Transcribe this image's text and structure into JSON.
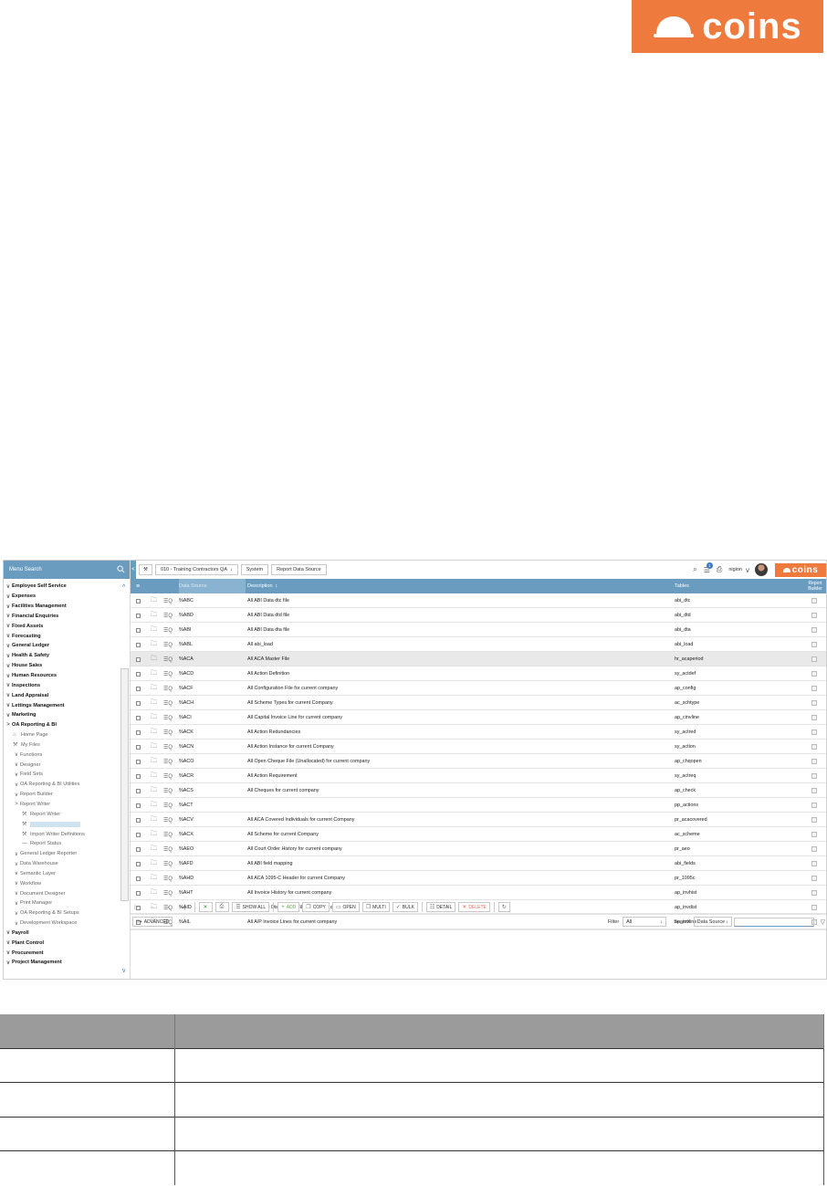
{
  "brand": {
    "logo_text": "coins",
    "accent_color": "#ee7a3d",
    "header_color": "#6a9cc0"
  },
  "sidebar": {
    "search_label": "Menu Search",
    "items": [
      {
        "label": "Employee Self Service",
        "level": "top",
        "chevron": "v"
      },
      {
        "label": "Expenses",
        "level": "top",
        "chevron": "v"
      },
      {
        "label": "Facilities Management",
        "level": "top",
        "chevron": "v"
      },
      {
        "label": "Financial Enquiries",
        "level": "top",
        "chevron": "v"
      },
      {
        "label": "Fixed Assets",
        "level": "top",
        "chevron": "v"
      },
      {
        "label": "Forecasting",
        "level": "top",
        "chevron": "v"
      },
      {
        "label": "General Ledger",
        "level": "top",
        "chevron": "v"
      },
      {
        "label": "Health & Safety",
        "level": "top",
        "chevron": "v"
      },
      {
        "label": "House Sales",
        "level": "top",
        "chevron": "v"
      },
      {
        "label": "Human Resources",
        "level": "top",
        "chevron": "v"
      },
      {
        "label": "Inspections",
        "level": "top",
        "chevron": "v"
      },
      {
        "label": "Land Appraisal",
        "level": "top",
        "chevron": "v"
      },
      {
        "label": "Lettings Management",
        "level": "top",
        "chevron": "v"
      },
      {
        "label": "Marketing",
        "level": "top",
        "chevron": "v"
      },
      {
        "label": "OA Reporting & BI",
        "level": "top",
        "chevron": ">"
      },
      {
        "label": "Home Page",
        "level": "l1",
        "icon": "home-icon"
      },
      {
        "label": "My Files",
        "level": "l1",
        "icon": "tool-icon"
      },
      {
        "label": "Functions",
        "level": "l1",
        "chevron": "v"
      },
      {
        "label": "Designer",
        "level": "l1",
        "chevron": "v"
      },
      {
        "label": "Field Sets",
        "level": "l1",
        "chevron": "v"
      },
      {
        "label": "OA Reporting & BI Utilities",
        "level": "l1",
        "chevron": "v"
      },
      {
        "label": "Report Builder",
        "level": "l1",
        "chevron": "v"
      },
      {
        "label": "Report Writer",
        "level": "l1",
        "chevron": ">"
      },
      {
        "label": "Report Writer",
        "level": "l2",
        "icon": "tool-icon"
      },
      {
        "label": "Report Data Source",
        "level": "l2",
        "icon": "tool-icon",
        "selected": true
      },
      {
        "label": "Import Writer Definitions",
        "level": "l2",
        "icon": "tool-icon"
      },
      {
        "label": "Report Status",
        "level": "l2",
        "icon": "dash-icon"
      },
      {
        "label": "General Ledger Reporter",
        "level": "l1",
        "chevron": "v"
      },
      {
        "label": "Data Warehouse",
        "level": "l1",
        "chevron": "v"
      },
      {
        "label": "Semantic Layer",
        "level": "l1",
        "chevron": "v"
      },
      {
        "label": "Workflow",
        "level": "l1",
        "chevron": "v"
      },
      {
        "label": "Document Designer",
        "level": "l1",
        "chevron": "v"
      },
      {
        "label": "Print Manager",
        "level": "l1",
        "chevron": "v"
      },
      {
        "label": "OA Reporting & BI Setups",
        "level": "l1",
        "chevron": "v"
      },
      {
        "label": "Development Workspace",
        "level": "l1",
        "chevron": "v"
      },
      {
        "label": "Payroll",
        "level": "top",
        "chevron": "v"
      },
      {
        "label": "Plant Control",
        "level": "top",
        "chevron": "v"
      },
      {
        "label": "Procurement",
        "level": "top",
        "chevron": "v"
      },
      {
        "label": "Project Management",
        "level": "top",
        "chevron": "v"
      }
    ]
  },
  "topbar": {
    "collapse": "<",
    "breadcrumbs": [
      "010 - Training Contractors QA",
      "System",
      "Report Data Source"
    ],
    "notification_count": "1",
    "user": "nigion",
    "logo_text": "coins"
  },
  "grid": {
    "headers": {
      "data_source": "Data Source",
      "description": "Description",
      "tables": "Tables",
      "report_builder": "Report Builder"
    },
    "rows": [
      {
        "ds": "%ABC",
        "desc": "All ABI Data dtc file",
        "tbl": "abi_dtc"
      },
      {
        "ds": "%ABD",
        "desc": "All ABI Data dtd file",
        "tbl": "abi_dtd"
      },
      {
        "ds": "%ABI",
        "desc": "All ABI Data dta file",
        "tbl": "abi_dta"
      },
      {
        "ds": "%ABL",
        "desc": "All abi_load",
        "tbl": "abi_load"
      },
      {
        "ds": "%ACA",
        "desc": "All ACA Master File",
        "tbl": "hr_acaperiod",
        "selected": true
      },
      {
        "ds": "%ACD",
        "desc": "All Action Definition",
        "tbl": "sy_actdef"
      },
      {
        "ds": "%ACF",
        "desc": "All Configuration File for current company",
        "tbl": "ap_config"
      },
      {
        "ds": "%ACH",
        "desc": "All Scheme Types for current Company",
        "tbl": "ac_schtype"
      },
      {
        "ds": "%ACI",
        "desc": "All Capital Invoice Line for current company",
        "tbl": "ap_cinvline"
      },
      {
        "ds": "%ACK",
        "desc": "All Action Redundancies",
        "tbl": "sy_actred"
      },
      {
        "ds": "%ACN",
        "desc": "All Action Instance for current Company",
        "tbl": "sy_action"
      },
      {
        "ds": "%ACO",
        "desc": "All Open Cheque File (Unallocated) for current company",
        "tbl": "ap_chqopen"
      },
      {
        "ds": "%ACR",
        "desc": "All Action Requirement",
        "tbl": "sy_actreq"
      },
      {
        "ds": "%ACS",
        "desc": "All Cheques for current company",
        "tbl": "ap_check"
      },
      {
        "ds": "%ACT",
        "desc": "",
        "tbl": "pp_actions"
      },
      {
        "ds": "%ACV",
        "desc": "All ACA Covered Individuals for current Company",
        "tbl": "pr_acacovered"
      },
      {
        "ds": "%ACX",
        "desc": "All Scheme for current Company",
        "tbl": "ac_scheme"
      },
      {
        "ds": "%AEO",
        "desc": "All Court Order History for current company",
        "tbl": "pr_aeo"
      },
      {
        "ds": "%AFD",
        "desc": "All ABI field mapping",
        "tbl": "abi_fields"
      },
      {
        "ds": "%AHD",
        "desc": "All ACA 1095-C Header for current Company",
        "tbl": "pr_1095c"
      },
      {
        "ds": "%AHT",
        "desc": "All Invoice History for current company",
        "tbl": "ap_invhist"
      },
      {
        "ds": "%AID",
        "desc": "All Invoice Distribution File for current company",
        "tbl": "ap_invdist"
      },
      {
        "ds": "%AIL",
        "desc": "All A/P Invoice Lines for current company",
        "tbl": "ap_invline"
      }
    ]
  },
  "toolbar": {
    "show_all": "SHOW ALL",
    "add": "ADD",
    "copy": "COPY",
    "open": "OPEN",
    "multi": "MULTI",
    "bulk": "BULK",
    "detail": "DETAIL",
    "delete": "DELETE"
  },
  "filterbar": {
    "advanced": "ADVANCED",
    "filter_label": "Filter",
    "filter_value": "All",
    "search_label": "Search",
    "search_field": "Data Source",
    "search_value": ""
  }
}
